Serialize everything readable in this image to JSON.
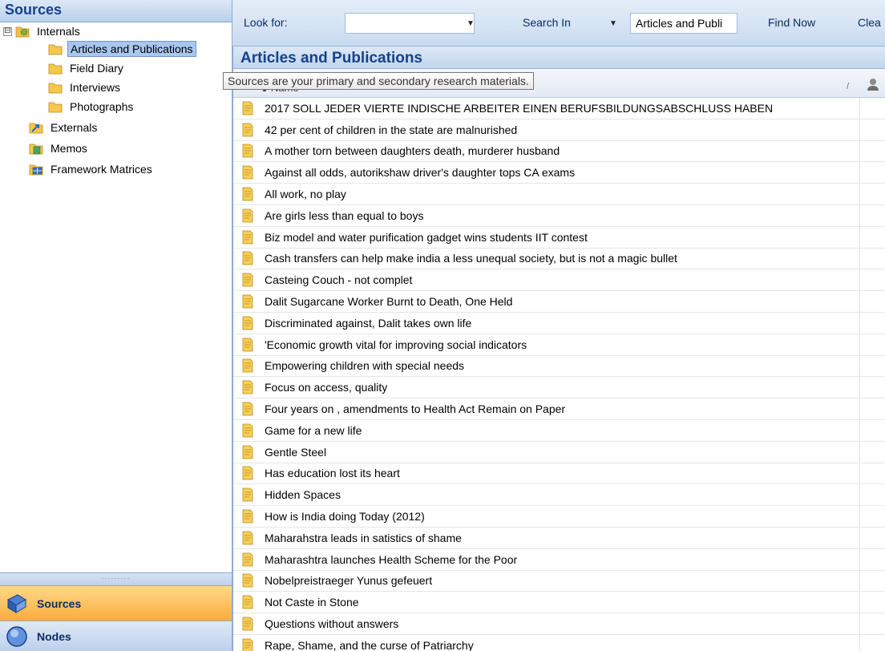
{
  "left_panel": {
    "title": "Sources",
    "tree": [
      {
        "label": "Internals",
        "expander": "⊟",
        "icon": "internals-folder-icon"
      },
      {
        "label": "Articles and Publications",
        "icon": "folder-icon",
        "selected": true
      },
      {
        "label": "Field Diary",
        "icon": "folder-icon"
      },
      {
        "label": "Interviews",
        "icon": "folder-icon"
      },
      {
        "label": "Photographs",
        "icon": "folder-icon"
      },
      {
        "label": "Externals",
        "icon": "externals-icon"
      },
      {
        "label": "Memos",
        "icon": "memos-icon"
      },
      {
        "label": "Framework Matrices",
        "icon": "framework-matrices-icon"
      }
    ],
    "splitter_grip": "·········",
    "nav": {
      "sources_label": "Sources",
      "nodes_label": "Nodes"
    }
  },
  "find_bar": {
    "look_for_label": "Look for:",
    "look_for_value": "",
    "search_in_label": "Search In",
    "search_in_value": "Articles and Publi",
    "find_now_label": "Find Now",
    "clear_label": "Clea",
    "dropdown_arrow": "▼"
  },
  "list": {
    "title": "Articles and Publications",
    "tooltip": "Sources are your primary and secondary research materials.",
    "column_name": "Name",
    "sort_arrow": "▲",
    "edit_icon": "/",
    "items": [
      "2017 SOLL JEDER VIERTE INDISCHE ARBEITER EINEN BERUFSBILDUNGSABSCHLUSS HABEN",
      "42 per cent of children in the state are malnurished",
      "A mother torn between daughters death, murderer husband",
      "Against all odds, autorikshaw driver's daughter tops CA exams",
      "All work, no play",
      "Are girls less than equal to boys",
      "Biz model and water purification gadget wins students IIT contest",
      "Cash transfers can help make india a less unequal society, but is not a magic bullet",
      "Casteing Couch - not complet",
      "Dalit Sugarcane Worker Burnt to Death, One Held",
      "Discriminated against, Dalit takes own life",
      "'Economic growth vital for improving social indicators",
      "Empowering children with special needs",
      "Focus on access, quality",
      "Four years on , amendments to Health Act Remain on Paper",
      "Game for a new life",
      "Gentle Steel",
      "Has education lost its heart",
      "Hidden Spaces",
      "How is India doing Today (2012)",
      "Maharahstra leads in satistics of shame",
      "Maharashtra launches Health Scheme for the Poor",
      "Nobelpreistraeger Yunus gefeuert",
      "Not Caste in Stone",
      "Questions without answers",
      "Rape, Shame, and the curse of Patriarchy"
    ]
  }
}
